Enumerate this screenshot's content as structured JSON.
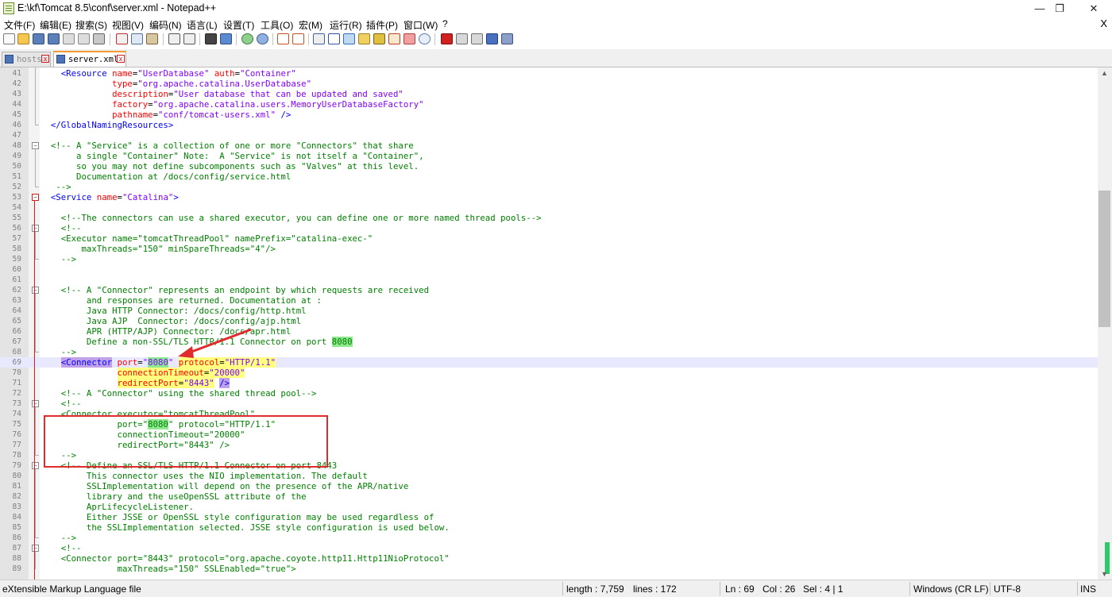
{
  "window": {
    "title": "E:\\kf\\Tomcat 8.5\\conf\\server.xml - Notepad++",
    "minimize": "—",
    "maximize": "❐",
    "close": "✕"
  },
  "menu": {
    "items": [
      "文件(F)",
      "编辑(E)",
      "搜索(S)",
      "视图(V)",
      "编码(N)",
      "语言(L)",
      "设置(T)",
      "工具(O)",
      "宏(M)",
      "运行(R)",
      "插件(P)",
      "窗口(W)",
      "?"
    ],
    "close": "X"
  },
  "toolbar": {
    "icons": [
      "new-file-icon",
      "open-file-icon",
      "save-icon",
      "save-all-icon",
      "close-icon",
      "close-all-icon",
      "print-icon",
      "cut-icon",
      "copy-icon",
      "paste-icon",
      "undo-icon",
      "redo-icon",
      "find-icon",
      "replace-icon",
      "zoom-in-icon",
      "zoom-out-icon",
      "sync-vertical-icon",
      "sync-horizontal-icon",
      "word-wrap-icon",
      "show-all-chars-icon",
      "indent-guide-icon",
      "language-icon",
      "doc-map-icon",
      "function-list-icon",
      "folder-workspace-icon",
      "monitoring-icon",
      "record-macro-icon",
      "stop-macro-icon",
      "play-macro-icon",
      "run-macro-multiple-icon",
      "save-macro-icon"
    ]
  },
  "tabs": [
    {
      "label": "hosts",
      "close": "x"
    },
    {
      "label": "server.xml",
      "close": "x"
    }
  ],
  "editor": {
    "lines": [
      {
        "n": "41",
        "fold": "",
        "segs": [
          [
            "p",
            "    "
          ],
          [
            "t",
            "<Resource "
          ],
          [
            "a",
            "name"
          ],
          [
            "p",
            "="
          ],
          [
            "v",
            "\"UserDatabase\""
          ],
          [
            "p",
            " "
          ],
          [
            "a",
            "auth"
          ],
          [
            "p",
            "="
          ],
          [
            "v",
            "\"Container\""
          ]
        ]
      },
      {
        "n": "42",
        "fold": "",
        "segs": [
          [
            "p",
            "              "
          ],
          [
            "a",
            "type"
          ],
          [
            "p",
            "="
          ],
          [
            "v",
            "\"org.apache.catalina.UserDatabase\""
          ]
        ]
      },
      {
        "n": "43",
        "fold": "",
        "segs": [
          [
            "p",
            "              "
          ],
          [
            "a",
            "description"
          ],
          [
            "p",
            "="
          ],
          [
            "v",
            "\"User database that can be updated and saved\""
          ]
        ]
      },
      {
        "n": "44",
        "fold": "",
        "segs": [
          [
            "p",
            "              "
          ],
          [
            "a",
            "factory"
          ],
          [
            "p",
            "="
          ],
          [
            "v",
            "\"org.apache.catalina.users.MemoryUserDatabaseFactory\""
          ]
        ]
      },
      {
        "n": "45",
        "fold": "",
        "segs": [
          [
            "p",
            "              "
          ],
          [
            "a",
            "pathname"
          ],
          [
            "p",
            "="
          ],
          [
            "v",
            "\"conf/tomcat-users.xml\""
          ],
          [
            "t",
            " />"
          ]
        ]
      },
      {
        "n": "46",
        "fold": "end",
        "segs": [
          [
            "p",
            "  "
          ],
          [
            "t",
            "</GlobalNamingResources>"
          ]
        ]
      },
      {
        "n": "47",
        "fold": "",
        "segs": []
      },
      {
        "n": "48",
        "fold": "box",
        "segs": [
          [
            "p",
            "  "
          ],
          [
            "c",
            "<!-- A \"Service\" is a collection of one or more \"Connectors\" that share"
          ]
        ]
      },
      {
        "n": "49",
        "fold": "",
        "segs": [
          [
            "c",
            "       a single \"Container\" Note:  A \"Service\" is not itself a \"Container\","
          ]
        ]
      },
      {
        "n": "50",
        "fold": "",
        "segs": [
          [
            "c",
            "       so you may not define subcomponents such as \"Valves\" at this level."
          ]
        ]
      },
      {
        "n": "51",
        "fold": "",
        "segs": [
          [
            "c",
            "       Documentation at /docs/config/service.html"
          ]
        ]
      },
      {
        "n": "52",
        "fold": "end",
        "segs": [
          [
            "c",
            "   -->"
          ]
        ]
      },
      {
        "n": "53",
        "fold": "redbox",
        "segs": [
          [
            "p",
            "  "
          ],
          [
            "t",
            "<Service "
          ],
          [
            "a",
            "name"
          ],
          [
            "p",
            "="
          ],
          [
            "v",
            "\"Catalina\""
          ],
          [
            "t",
            ">"
          ]
        ]
      },
      {
        "n": "54",
        "fold": "",
        "segs": []
      },
      {
        "n": "55",
        "fold": "",
        "segs": [
          [
            "p",
            "    "
          ],
          [
            "c",
            "<!--The connectors can use a shared executor, you can define one or more named thread pools-->"
          ]
        ]
      },
      {
        "n": "56",
        "fold": "box",
        "segs": [
          [
            "p",
            "    "
          ],
          [
            "c",
            "<!--"
          ]
        ]
      },
      {
        "n": "57",
        "fold": "",
        "segs": [
          [
            "c",
            "    <Executor name=\"tomcatThreadPool\" namePrefix=\"catalina-exec-\""
          ]
        ]
      },
      {
        "n": "58",
        "fold": "",
        "segs": [
          [
            "c",
            "        maxThreads=\"150\" minSpareThreads=\"4\"/>"
          ]
        ]
      },
      {
        "n": "59",
        "fold": "end",
        "segs": [
          [
            "c",
            "    -->"
          ]
        ]
      },
      {
        "n": "60",
        "fold": "",
        "segs": []
      },
      {
        "n": "61",
        "fold": "",
        "segs": []
      },
      {
        "n": "62",
        "fold": "box",
        "segs": [
          [
            "p",
            "    "
          ],
          [
            "c",
            "<!-- A \"Connector\" represents an endpoint by which requests are received"
          ]
        ]
      },
      {
        "n": "63",
        "fold": "",
        "segs": [
          [
            "c",
            "         and responses are returned. Documentation at :"
          ]
        ]
      },
      {
        "n": "64",
        "fold": "",
        "segs": [
          [
            "c",
            "         Java HTTP Connector: /docs/config/http.html"
          ]
        ]
      },
      {
        "n": "65",
        "fold": "",
        "segs": [
          [
            "c",
            "         Java AJP  Connector: /docs/config/ajp.html"
          ]
        ]
      },
      {
        "n": "66",
        "fold": "",
        "segs": [
          [
            "c",
            "         APR (HTTP/AJP) Connector: /docs/apr.html"
          ]
        ]
      },
      {
        "n": "67",
        "fold": "",
        "segs": [
          [
            "c",
            "         Define a non-SSL/TLS HTTP/1.1 Connector on port "
          ],
          [
            "cn",
            "8080"
          ]
        ]
      },
      {
        "n": "68",
        "fold": "end",
        "segs": [
          [
            "c",
            "    -->"
          ]
        ]
      },
      {
        "n": "69",
        "fold": "",
        "cur": true,
        "segs": [
          [
            "p",
            "    "
          ],
          [
            "th",
            "<Connector"
          ],
          [
            "p",
            " "
          ],
          [
            "a",
            "port"
          ],
          [
            "p",
            "="
          ],
          [
            "v",
            "\""
          ],
          [
            "vn",
            "8080"
          ],
          [
            "v",
            "\""
          ],
          [
            "p",
            " "
          ],
          [
            "as",
            "protocol"
          ],
          [
            "ps",
            "="
          ],
          [
            "vs",
            "\"HTTP/1.1\""
          ]
        ]
      },
      {
        "n": "70",
        "fold": "",
        "segs": [
          [
            "p",
            "               "
          ],
          [
            "as",
            "connectionTimeout"
          ],
          [
            "ps",
            "="
          ],
          [
            "vs",
            "\"20000\""
          ]
        ]
      },
      {
        "n": "71",
        "fold": "",
        "segs": [
          [
            "p",
            "               "
          ],
          [
            "as",
            "redirectPort"
          ],
          [
            "ps",
            "="
          ],
          [
            "vs",
            "\"8443\""
          ],
          [
            "p",
            " "
          ],
          [
            "th",
            "/>"
          ]
        ]
      },
      {
        "n": "72",
        "fold": "",
        "segs": [
          [
            "p",
            "    "
          ],
          [
            "c",
            "<!-- A \"Connector\" using the shared thread pool-->"
          ]
        ]
      },
      {
        "n": "73",
        "fold": "box",
        "segs": [
          [
            "p",
            "    "
          ],
          [
            "c",
            "<!--"
          ]
        ]
      },
      {
        "n": "74",
        "fold": "",
        "segs": [
          [
            "c",
            "    <Connector executor=\"tomcatThreadPool\""
          ]
        ]
      },
      {
        "n": "75",
        "fold": "",
        "segs": [
          [
            "c",
            "               port=\""
          ],
          [
            "cn",
            "8080"
          ],
          [
            "c",
            "\" protocol=\"HTTP/1.1\""
          ]
        ]
      },
      {
        "n": "76",
        "fold": "",
        "segs": [
          [
            "c",
            "               connectionTimeout=\"20000\""
          ]
        ]
      },
      {
        "n": "77",
        "fold": "",
        "segs": [
          [
            "c",
            "               redirectPort=\"8443\" />"
          ]
        ]
      },
      {
        "n": "78",
        "fold": "end",
        "segs": [
          [
            "c",
            "    -->"
          ]
        ]
      },
      {
        "n": "79",
        "fold": "box",
        "segs": [
          [
            "p",
            "    "
          ],
          [
            "c",
            "<!-- Define an SSL/TLS HTTP/1.1 Connector on port 8443"
          ]
        ]
      },
      {
        "n": "80",
        "fold": "",
        "segs": [
          [
            "c",
            "         This connector uses the NIO implementation. The default"
          ]
        ]
      },
      {
        "n": "81",
        "fold": "",
        "segs": [
          [
            "c",
            "         SSLImplementation will depend on the presence of the APR/native"
          ]
        ]
      },
      {
        "n": "82",
        "fold": "",
        "segs": [
          [
            "c",
            "         library and the useOpenSSL attribute of the"
          ]
        ]
      },
      {
        "n": "83",
        "fold": "",
        "segs": [
          [
            "c",
            "         AprLifecycleListener."
          ]
        ]
      },
      {
        "n": "84",
        "fold": "",
        "segs": [
          [
            "c",
            "         Either JSSE or OpenSSL style configuration may be used regardless of"
          ]
        ]
      },
      {
        "n": "85",
        "fold": "",
        "segs": [
          [
            "c",
            "         the SSLImplementation selected. JSSE style configuration is used below."
          ]
        ]
      },
      {
        "n": "86",
        "fold": "end",
        "segs": [
          [
            "c",
            "    -->"
          ]
        ]
      },
      {
        "n": "87",
        "fold": "box",
        "segs": [
          [
            "p",
            "    "
          ],
          [
            "c",
            "<!--"
          ]
        ]
      },
      {
        "n": "88",
        "fold": "",
        "segs": [
          [
            "c",
            "    <Connector port=\"8443\" protocol=\"org.apache.coyote.http11.Http11NioProtocol\""
          ]
        ]
      },
      {
        "n": "89",
        "fold": "",
        "segs": [
          [
            "c",
            "               maxThreads=\"150\" SSLEnabled=\"true\">"
          ]
        ]
      }
    ]
  },
  "scrollbar": {
    "up": "▲",
    "down": "▼"
  },
  "status": {
    "filetype": "eXtensible Markup Language file",
    "length": "length : 7,759",
    "lines": "lines : 172",
    "ln": "Ln : 69",
    "col": "Col : 26",
    "sel": "Sel : 4 | 1",
    "eol": "Windows (CR LF)",
    "encoding": "UTF-8",
    "mode": "INS"
  },
  "colors": {
    "tag": "#0000ff",
    "attribute": "#ff0000",
    "value": "#8000ff",
    "comment": "#008000",
    "annotation": "#e02c2c"
  }
}
